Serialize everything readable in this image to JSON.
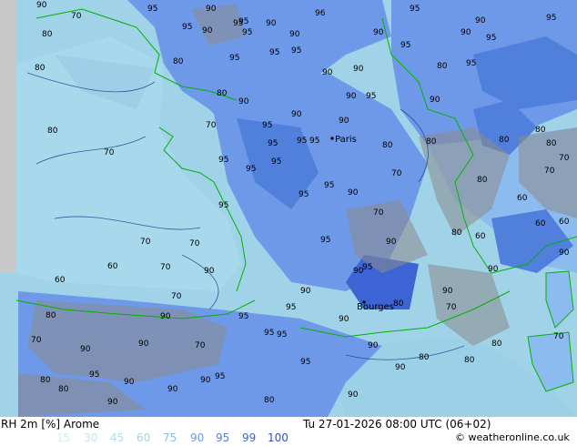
{
  "map": {
    "colors": {
      "frame": "#c8c8c8",
      "rh70": "#a0d2e8",
      "rh80": "#8cbcef",
      "rh90": "#6e98e8",
      "rh95": "#5080dc",
      "rh99": "#3c64d4",
      "land_shade": "#8c8c8c",
      "coast": "#00b400",
      "contour": "#143c8c"
    },
    "city_labels": [
      "Paris",
      "Bourges"
    ],
    "contour_labels": [
      "90",
      "70",
      "80",
      "95",
      "90",
      "95",
      "95",
      "90",
      "96",
      "95",
      "80",
      "90",
      "95",
      "95",
      "90",
      "90",
      "95",
      "90",
      "80",
      "80",
      "95",
      "95",
      "90",
      "95",
      "80",
      "95",
      "95",
      "90",
      "95",
      "90",
      "90",
      "95",
      "70",
      "80",
      "90",
      "95",
      "90",
      "70",
      "95",
      "95",
      "95",
      "90",
      "80",
      "80",
      "95",
      "95",
      "90",
      "95",
      "95",
      "95",
      "90",
      "70",
      "95",
      "70",
      "90",
      "95",
      "90",
      "80",
      "95",
      "90",
      "80",
      "95",
      "90",
      "70",
      "80",
      "90",
      "90",
      "80",
      "90",
      "95",
      "90",
      "70",
      "90",
      "80",
      "70",
      "95",
      "60",
      "90",
      "60",
      "80",
      "80",
      "60",
      "80",
      "70",
      "80",
      "70",
      "60",
      "90",
      "80",
      "95",
      "90",
      "95",
      "90",
      "80",
      "90",
      "80",
      "90",
      "95",
      "70",
      "90",
      "80",
      "95",
      "90",
      "90",
      "70",
      "60",
      "70",
      "60",
      "70",
      "70"
    ]
  },
  "footer": {
    "title": "RH 2m [%] Arome",
    "datetime": "Tu 27-01-2026 08:00 UTC (06+02)",
    "copyright": "© weatheronline.co.uk",
    "legend": [
      {
        "label": "15",
        "color": "#d2ecf4"
      },
      {
        "label": "30",
        "color": "#c2e3f0"
      },
      {
        "label": "45",
        "color": "#b2dbec"
      },
      {
        "label": "60",
        "color": "#a0d2e8"
      },
      {
        "label": "75",
        "color": "#8cbcef"
      },
      {
        "label": "90",
        "color": "#6e98e8"
      },
      {
        "label": "95",
        "color": "#5080dc"
      },
      {
        "label": "99",
        "color": "#3c64d4"
      },
      {
        "label": "100",
        "color": "#2850cc"
      }
    ]
  }
}
